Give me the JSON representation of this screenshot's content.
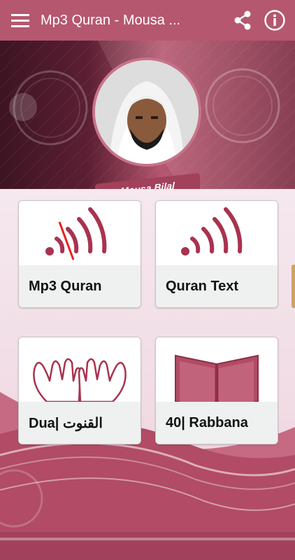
{
  "app_bar": {
    "title": "Mp3 Quran - Mousa ...",
    "menu_icon": "hamburger-menu-icon",
    "share_icon": "share-icon",
    "info_icon": "info-icon"
  },
  "banner": {
    "reciter_name": "Mousa Bilal"
  },
  "cards": [
    {
      "label": "Mp3 Quran",
      "icon": "audio-waves-muted-icon"
    },
    {
      "label": "Quran Text",
      "icon": "audio-waves-icon"
    },
    {
      "label": "Dua| القنوت",
      "icon": "praying-hands-icon"
    },
    {
      "label": "40| Rabbana",
      "icon": "open-book-icon"
    }
  ],
  "colors": {
    "primary": "#b5576f",
    "accent": "#a2415b",
    "card_bottom": "#eef1ef"
  }
}
